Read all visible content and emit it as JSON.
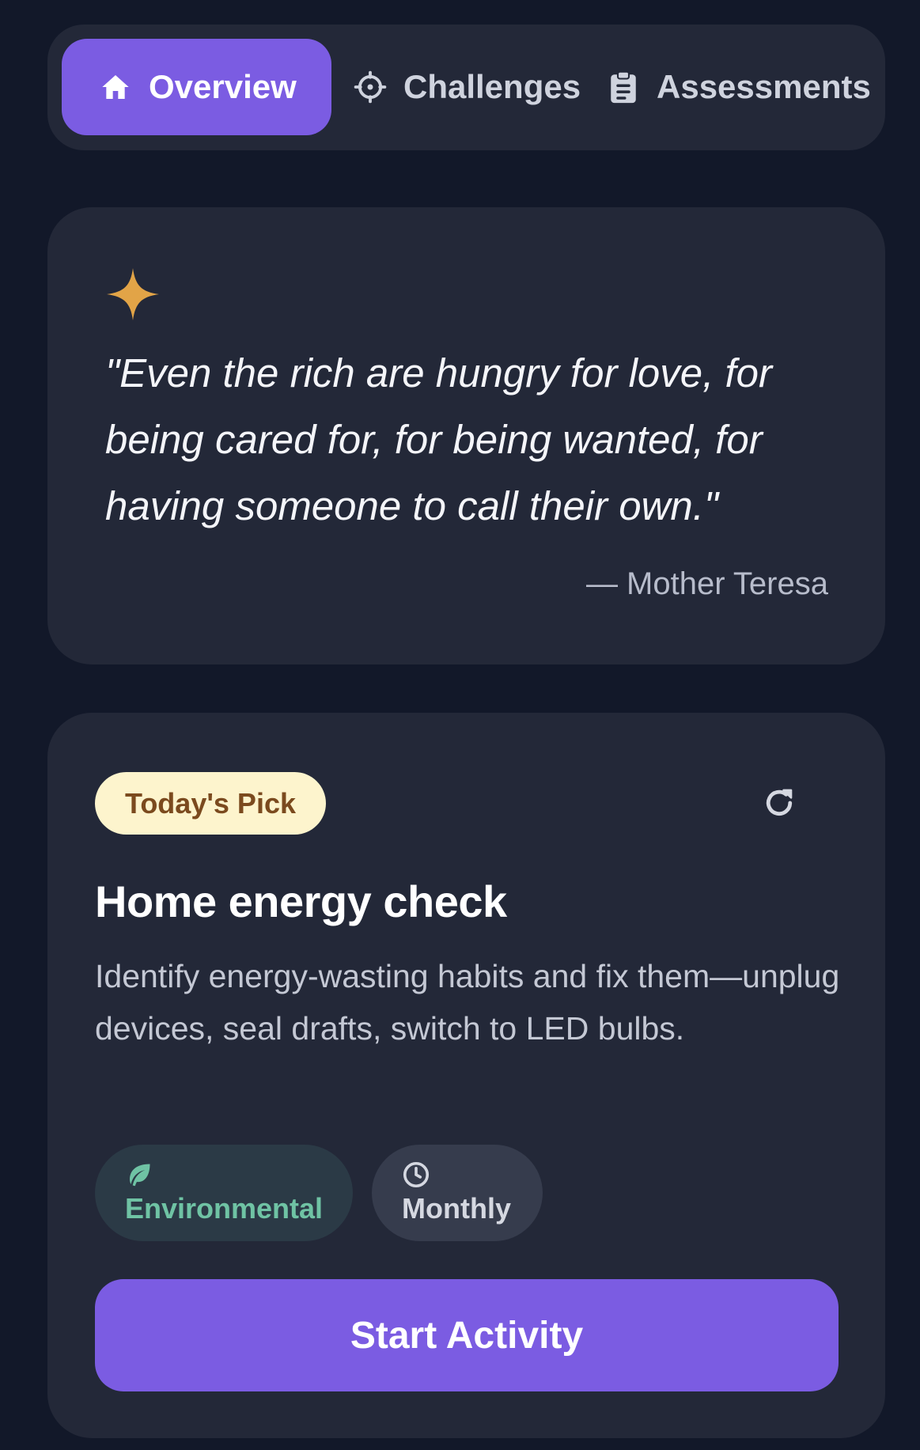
{
  "tabs": [
    {
      "label": "Overview",
      "icon": "home-icon",
      "active": true
    },
    {
      "label": "Challenges",
      "icon": "crosshair-icon",
      "active": false
    },
    {
      "label": "Assessments",
      "icon": "clipboard-icon",
      "active": false
    }
  ],
  "quote": {
    "icon": "sparkle-icon",
    "text": "\"Even the rich are hungry for love, for being cared for, for being wanted, for having someone to call their own.\"",
    "author": "— Mother Teresa"
  },
  "activity": {
    "badge": "Today's Pick",
    "refresh_icon": "refresh-icon",
    "title": "Home energy check",
    "description": "Identify energy-wasting habits and fix them—unplug devices, seal drafts, switch to LED bulbs.",
    "tags": [
      {
        "label": "Environmental",
        "icon": "leaf-icon"
      },
      {
        "label": "Monthly",
        "icon": "clock-icon"
      }
    ],
    "start_label": "Start Activity"
  },
  "colors": {
    "background": "#121829",
    "card": "#232838",
    "accent": "#7b5ce2",
    "badge_bg": "#fdf4cd",
    "badge_text": "#7b4a1e",
    "sparkle": "#e2a447",
    "environmental": "#6fc3a4"
  }
}
